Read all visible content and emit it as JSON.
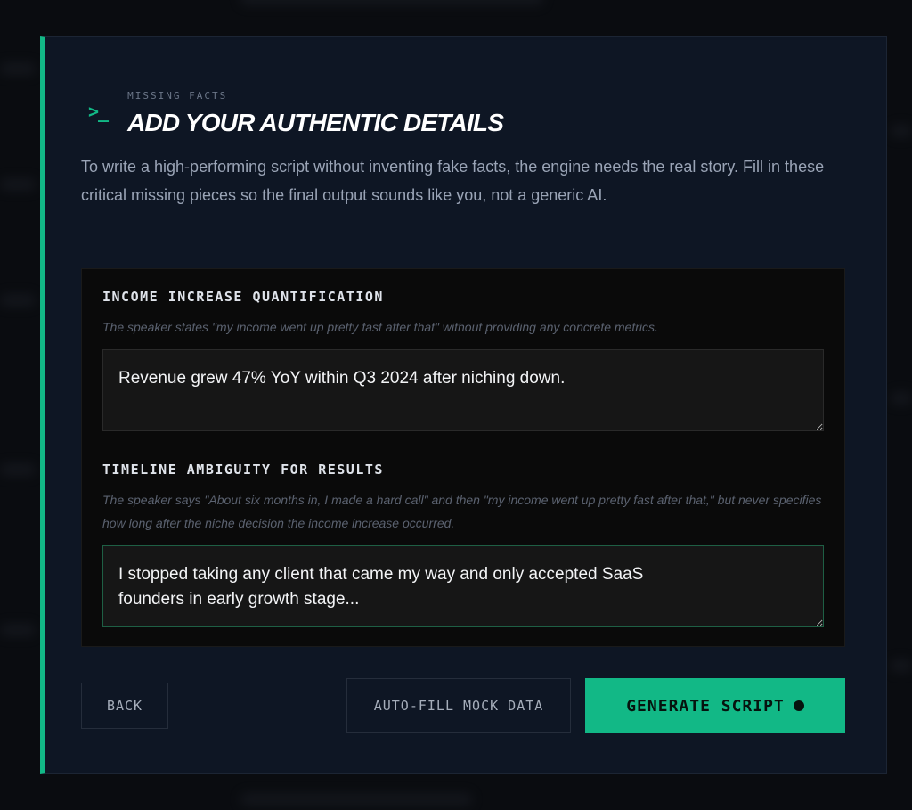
{
  "header": {
    "icon": "terminal-prompt-icon",
    "eyebrow": "MISSING FACTS",
    "title": "ADD YOUR AUTHENTIC DETAILS"
  },
  "intro": "To write a high-performing script without inventing fake facts, the engine needs the real story. Fill in these critical missing pieces so the final output sounds like you, not a generic AI.",
  "fields": [
    {
      "label": "INCOME INCREASE QUANTIFICATION",
      "description": "The speaker states \"my income went up pretty fast after that\" without providing any concrete metrics.",
      "value": "Revenue grew 47% YoY within Q3 2024 after niching down."
    },
    {
      "label": "TIMELINE AMBIGUITY FOR RESULTS",
      "description": "The speaker says \"About six months in, I made a hard call\" and then \"my income went up pretty fast after that,\" but never specifies how long after the niche decision the income increase occurred.",
      "value": "I stopped taking any client that came my way and only accepted SaaS\nfounders in early growth stage..."
    }
  ],
  "buttons": {
    "back": "BACK",
    "autofill": "AUTO-FILL MOCK DATA",
    "generate": "GENERATE SCRIPT"
  },
  "colors": {
    "accent": "#12b886",
    "background": "#0e1624",
    "panel": "#0a0a0a"
  }
}
